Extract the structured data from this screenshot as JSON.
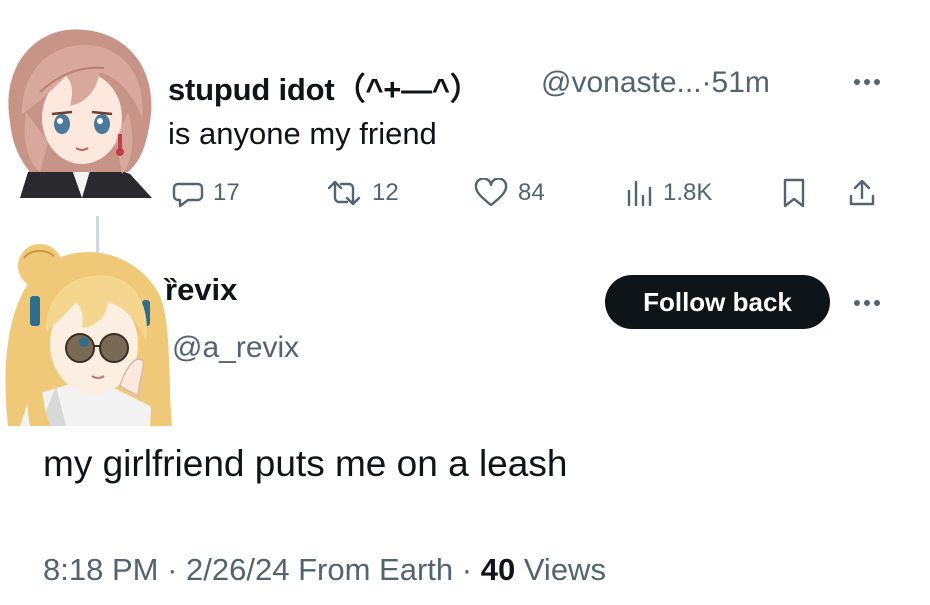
{
  "first_tweet": {
    "display_name": "stupud idot（^+—^）",
    "handle": "@vonaste...",
    "separator": "·",
    "time": "51m",
    "text": "is anyone my friend",
    "replies": "17",
    "retweets": "12",
    "likes": "84",
    "views": "1.8K"
  },
  "second_tweet": {
    "display_name": "ȑevix",
    "handle": "@a_revix",
    "follow_label": "Follow back",
    "text": "my girlfriend puts me on a leash",
    "time": "8:18 PM",
    "date": "2/26/24",
    "source": "From Earth",
    "views_count": "40",
    "views_label": "Views"
  },
  "colors": {
    "text": "#0f1419",
    "secondary": "#536471",
    "button_bg": "#0f1419",
    "button_text": "#ffffff"
  },
  "icons": [
    "more-icon",
    "reply-icon",
    "retweet-icon",
    "like-icon",
    "views-icon",
    "bookmark-icon",
    "share-icon"
  ]
}
